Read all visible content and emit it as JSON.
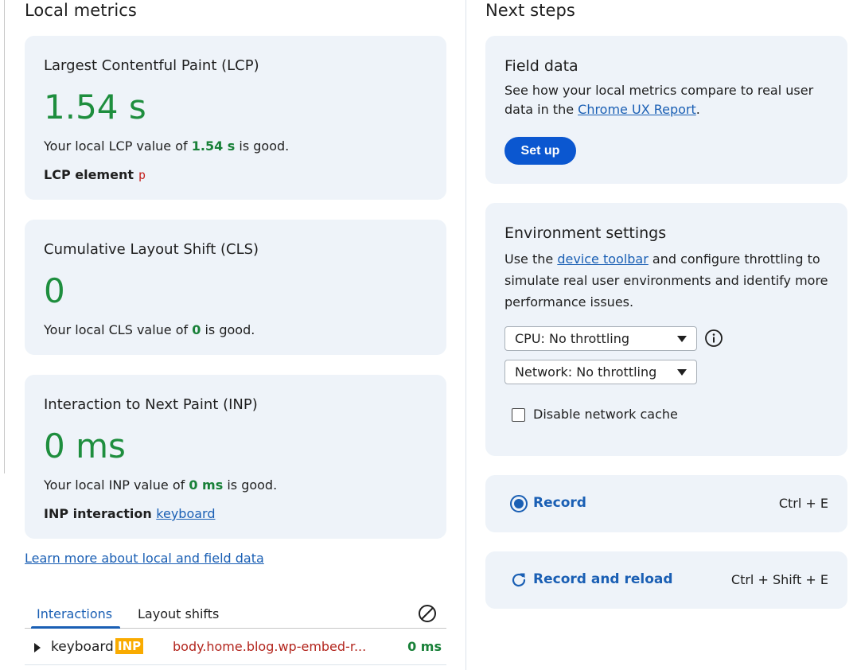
{
  "left": {
    "title": "Local metrics",
    "lcp": {
      "name": "Largest Contentful Paint (LCP)",
      "value": "1.54 s",
      "desc_prefix": "Your local LCP value of ",
      "desc_value": "1.54 s",
      "desc_suffix": " is good.",
      "element_label": "LCP element",
      "element_tag": "p"
    },
    "cls": {
      "name": "Cumulative Layout Shift (CLS)",
      "value": "0",
      "desc_prefix": "Your local CLS value of ",
      "desc_value": "0",
      "desc_suffix": " is good."
    },
    "inp": {
      "name": "Interaction to Next Paint (INP)",
      "value": "0 ms",
      "desc_prefix": "Your local INP value of ",
      "desc_value": "0 ms",
      "desc_suffix": " is good.",
      "interaction_label": "INP interaction",
      "interaction_link": "keyboard"
    },
    "learn_more": "Learn more about local and field data",
    "tabs": [
      {
        "label": "Interactions",
        "active": true
      },
      {
        "label": "Layout shifts",
        "active": false
      }
    ],
    "interactions": [
      {
        "type": "keyboard",
        "badge": "INP",
        "target": "body.home.blog.wp-embed-r...",
        "duration": "0 ms"
      }
    ]
  },
  "right": {
    "title": "Next steps",
    "field_data": {
      "title": "Field data",
      "text_prefix": "See how your local metrics compare to real user data in the ",
      "link": "Chrome UX Report",
      "text_suffix": ".",
      "button": "Set up"
    },
    "environment": {
      "title": "Environment settings",
      "text_prefix": "Use the ",
      "link": "device toolbar",
      "text_suffix": " and configure throttling to simulate real user environments and identify more performance issues.",
      "cpu_select": "CPU: No throttling",
      "network_select": "Network: No throttling",
      "checkbox_label": "Disable network cache",
      "checkbox_checked": false
    },
    "record": {
      "label": "Record",
      "shortcut": "Ctrl + E"
    },
    "record_reload": {
      "label": "Record and reload",
      "shortcut": "Ctrl + Shift + E"
    }
  },
  "colors": {
    "good": "#1e8e3e",
    "accent": "#1a5fb4",
    "card_bg": "#eef3f9",
    "badge": "#f9ab00"
  }
}
